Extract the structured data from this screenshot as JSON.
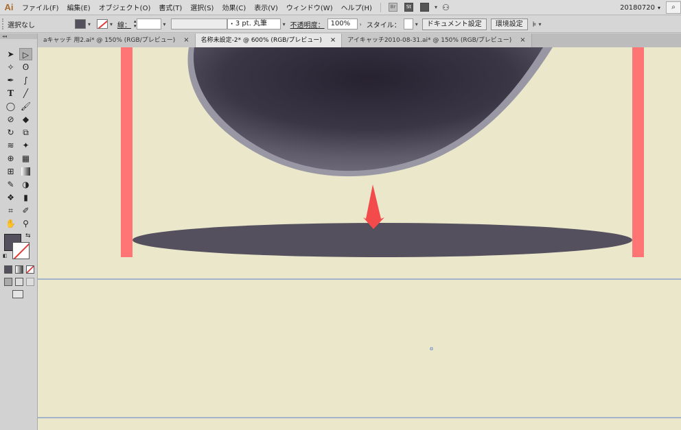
{
  "app": {
    "logo": "Ai"
  },
  "menu": {
    "items": [
      "ファイル(F)",
      "編集(E)",
      "オブジェクト(O)",
      "書式(T)",
      "選択(S)",
      "効果(C)",
      "表示(V)",
      "ウィンドウ(W)",
      "ヘルプ(H)"
    ],
    "bridge_label": "Br",
    "stock_label": "St",
    "workspace": "20180720",
    "search_icon": "search-icon"
  },
  "control": {
    "selection_status": "選択なし",
    "stroke_label": "線：",
    "brush_value": "3 pt. 丸筆",
    "opacity_label": "不透明度：",
    "opacity_value": "100%",
    "style_label": "スタイル：",
    "document_setup": "ドキュメント設定",
    "preferences": "環境設定",
    "fill_color": "#54505e"
  },
  "tabs": [
    {
      "label": "aキャッチ 用2.ai* @ 150% (RGB/プレビュー)",
      "close": "×",
      "active": false
    },
    {
      "label": "名称未設定-2* @ 600% (RGB/プレビュー)",
      "close": "×",
      "active": true
    },
    {
      "label": "アイキャッチ2010-08-31.ai* @ 150% (RGB/プレビュー)",
      "close": "×",
      "active": false
    }
  ],
  "tools": {
    "collapse_label": "◂◂",
    "items": [
      [
        "selection-tool",
        "direct-selection-tool"
      ],
      [
        "magic-wand-tool",
        "lasso-tool"
      ],
      [
        "pen-tool",
        "curvature-tool"
      ],
      [
        "type-tool",
        "line-tool"
      ],
      [
        "ellipse-tool",
        "paintbrush-tool"
      ],
      [
        "shaper-tool",
        "eraser-tool"
      ],
      [
        "rotate-tool",
        "scale-tool"
      ],
      [
        "width-tool",
        "puppet-warp-tool"
      ],
      [
        "shape-builder-tool",
        "perspective-grid-tool"
      ],
      [
        "mesh-tool",
        "gradient-tool"
      ],
      [
        "eyedropper-tool",
        "blend-tool"
      ],
      [
        "symbol-sprayer-tool",
        "column-graph-tool"
      ],
      [
        "artboard-tool",
        "slice-tool"
      ],
      [
        "hand-tool",
        "zoom-tool"
      ]
    ],
    "fill_color": "#54505e",
    "stroke_color": "none"
  },
  "canvas": {
    "background": "#eae7ca",
    "guide_color": "#ff7474",
    "shape_color": "#54505e",
    "arrow_color": "#f34b4b"
  }
}
